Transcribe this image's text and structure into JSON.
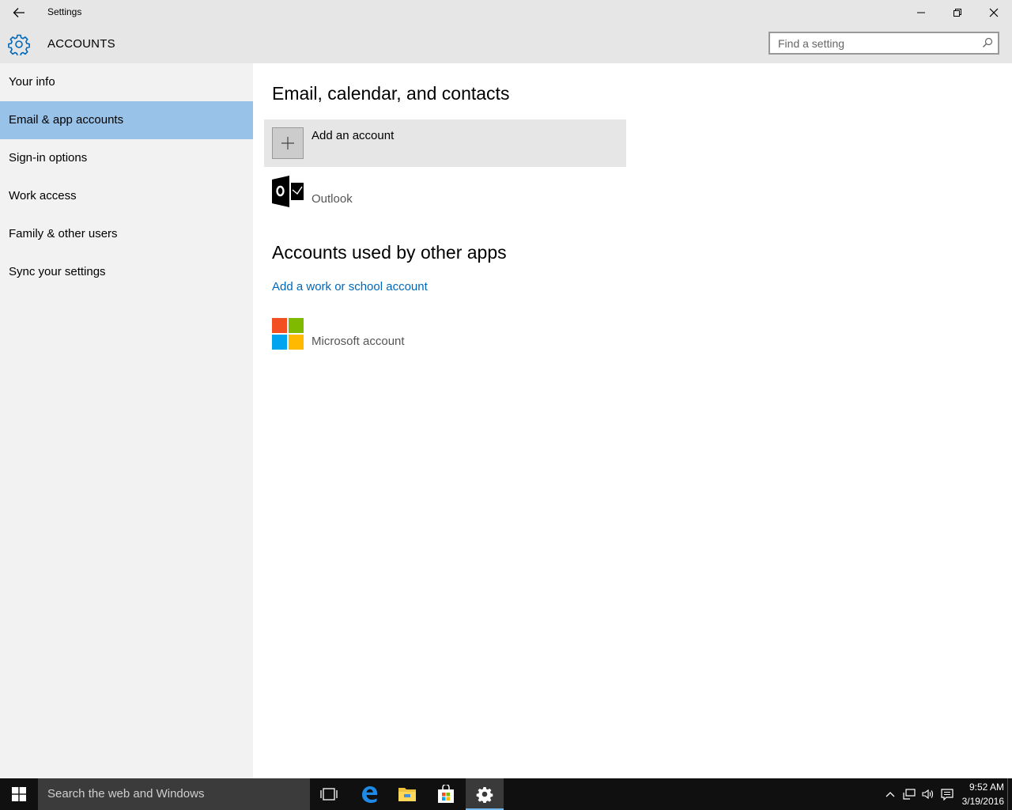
{
  "window": {
    "title": "Settings"
  },
  "header": {
    "title": "ACCOUNTS",
    "search_placeholder": "Find a setting"
  },
  "sidebar": {
    "items": [
      {
        "label": "Your info",
        "active": false
      },
      {
        "label": "Email & app accounts",
        "active": true
      },
      {
        "label": "Sign-in options",
        "active": false
      },
      {
        "label": "Work access",
        "active": false
      },
      {
        "label": "Family & other users",
        "active": false
      },
      {
        "label": "Sync your settings",
        "active": false
      }
    ]
  },
  "main": {
    "section1_heading": "Email, calendar, and contacts",
    "add_account_label": "Add an account",
    "outlook_label": "Outlook",
    "section2_heading": "Accounts used by other apps",
    "add_work_link": "Add a work or school account",
    "microsoft_account_label": "Microsoft account"
  },
  "taskbar": {
    "search_text": "Search the web and Windows",
    "time": "9:52 AM",
    "date": "3/19/2016",
    "pinned": [
      "task-view-icon",
      "edge-icon",
      "file-explorer-icon",
      "store-icon",
      "settings-icon"
    ]
  },
  "colors": {
    "accent": "#0067b8",
    "selected_nav": "#99c2e8",
    "chrome": "#e6e6e6",
    "sidebar": "#f2f2f2",
    "taskbar": "#101010"
  }
}
